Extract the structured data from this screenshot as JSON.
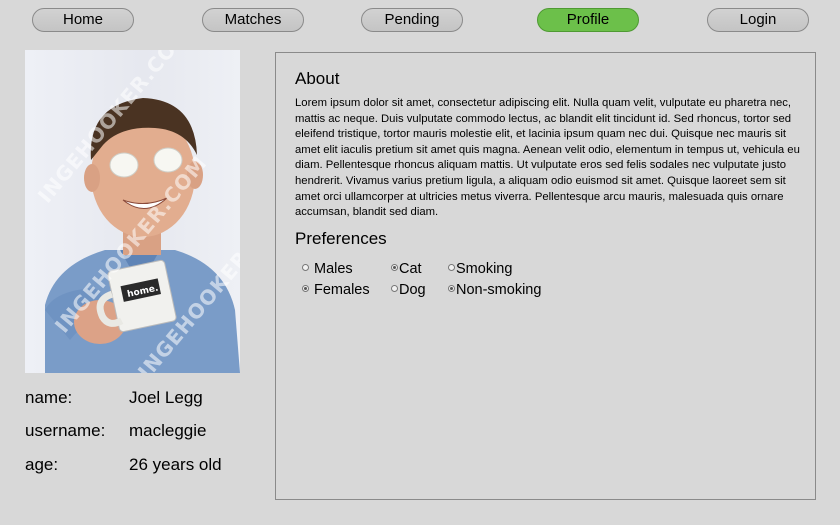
{
  "nav": {
    "home": "Home",
    "matches": "Matches",
    "pending": "Pending",
    "profile": "Profile",
    "login": "Login"
  },
  "profile": {
    "watermark": "INGEHOOKER.COM",
    "name_label": "name:",
    "name_value": "Joel Legg",
    "username_label": "username:",
    "username_value": "macleggie",
    "age_label": "age:",
    "age_value": "26 years old",
    "mug_text": "home."
  },
  "about": {
    "title": "About",
    "text": "Lorem ipsum dolor sit amet, consectetur adipiscing elit. Nulla quam velit, vulputate eu pharetra nec, mattis ac neque. Duis vulputate commodo lectus, ac blandit elit tincidunt id. Sed rhoncus, tortor sed eleifend tristique, tortor mauris molestie elit, et lacinia ipsum quam nec dui. Quisque nec mauris sit amet elit iaculis pretium sit amet quis magna. Aenean velit odio, elementum in tempus ut, vehicula eu diam. Pellentesque rhoncus aliquam mattis. Ut vulputate eros sed felis sodales nec vulputate justo hendrerit. Vivamus varius pretium ligula, a aliquam odio euismod sit amet. Quisque laoreet sem sit amet orci ullamcorper at ultricies metus viverra. Pellentesque arcu mauris, malesuada quis ornare accumsan, blandit sed diam."
  },
  "preferences": {
    "title": "Preferences",
    "males": "Males",
    "females": "Females",
    "cat": "Cat",
    "dog": "Dog",
    "smoking": "Smoking",
    "non_smoking": "Non-smoking"
  },
  "colors": {
    "active_tab": "#6cc04a",
    "background": "#d8d8d8"
  }
}
